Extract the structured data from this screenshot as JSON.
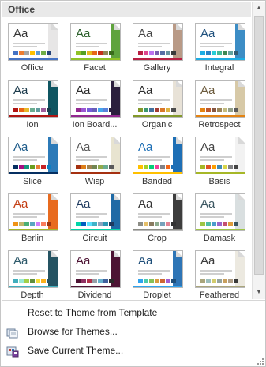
{
  "header": {
    "title": "Office"
  },
  "themes": [
    {
      "name": "Office",
      "aa": "#333333",
      "side": "#e7e6e6",
      "bar": "#4472c4",
      "sw": [
        "#4472c4",
        "#ed7d31",
        "#a5a5a5",
        "#ffc000",
        "#5b9bd5",
        "#70ad47",
        "#264478"
      ]
    },
    {
      "name": "Facet",
      "aa": "#2a5f2a",
      "side": "#5fa33d",
      "bar": "#90c226",
      "sw": [
        "#90c226",
        "#54a021",
        "#e6b91e",
        "#e76618",
        "#c42f1a",
        "#918655",
        "#3a6b1b"
      ]
    },
    {
      "name": "Gallery",
      "aa": "#444444",
      "side": "#b99a86",
      "bar": "#b71e42",
      "sw": [
        "#b71e42",
        "#de478e",
        "#bc72f0",
        "#795faf",
        "#586ea6",
        "#6892a0",
        "#3a3a3a"
      ]
    },
    {
      "name": "Integral",
      "aa": "#1d4f7c",
      "side": "#3c8dc5",
      "bar": "#1cade4",
      "sw": [
        "#1cade4",
        "#2683c6",
        "#27ced7",
        "#42ba97",
        "#3e8853",
        "#62a39f",
        "#335b74"
      ]
    },
    {
      "name": "Ion",
      "aa": "#1b3a4b",
      "side": "#0f5561",
      "bar": "#b01513",
      "sw": [
        "#b01513",
        "#ea6312",
        "#e6b729",
        "#6aac90",
        "#5f9c9d",
        "#9e5e9b",
        "#1b3a4b"
      ]
    },
    {
      "name": "Ion Board...",
      "aa": "#2a2a2a",
      "side": "#2b1f3d",
      "bar": "#92278f",
      "sw": [
        "#92278f",
        "#9b57d3",
        "#755dd9",
        "#665eb8",
        "#45a5ed",
        "#5982db",
        "#2b1f3d"
      ]
    },
    {
      "name": "Organic",
      "aa": "#2a2a2a",
      "side": "#e8e2d7",
      "bar": "#83992a",
      "sw": [
        "#83992a",
        "#3c9770",
        "#44709d",
        "#a23c33",
        "#d97828",
        "#deb340",
        "#4d4d4d"
      ]
    },
    {
      "name": "Retrospect",
      "aa": "#6b5a3c",
      "side": "#d7c9a7",
      "bar": "#e48312",
      "sw": [
        "#e48312",
        "#bd582c",
        "#865640",
        "#9b8357",
        "#c2bc80",
        "#94a088",
        "#5a5a5a"
      ]
    },
    {
      "name": "Slice",
      "aa": "#1e5c8a",
      "side": "#2c7ab8",
      "bar": "#052f61",
      "sw": [
        "#052f61",
        "#a50e82",
        "#14967c",
        "#6a9e1f",
        "#e87d37",
        "#c62324",
        "#0b7fc3"
      ]
    },
    {
      "name": "Wisp",
      "aa": "#555555",
      "side": "#e8e4d0",
      "bar": "#a53010",
      "sw": [
        "#a53010",
        "#de7e18",
        "#9f8351",
        "#728653",
        "#92aa4c",
        "#6aac91",
        "#5a5a5a"
      ]
    },
    {
      "name": "Banded",
      "aa": "#1e6fb5",
      "side": "#1e6fb5",
      "bar": "#ffc000",
      "sw": [
        "#ffc000",
        "#a5d028",
        "#08cc78",
        "#f24099",
        "#828288",
        "#f56617",
        "#1e6fb5"
      ]
    },
    {
      "name": "Basis",
      "aa": "#444444",
      "side": "#f2f2f2",
      "bar": "#a6b727",
      "sw": [
        "#a6b727",
        "#df5327",
        "#fe9e00",
        "#418ab3",
        "#d7d447",
        "#818183",
        "#444444"
      ]
    },
    {
      "name": "Berlin",
      "aa": "#c33e14",
      "side": "#e86b1f",
      "bar": "#a6b727",
      "sw": [
        "#f09415",
        "#c1b56b",
        "#4baf73",
        "#5aa6c0",
        "#d17df9",
        "#fa7e5c",
        "#9e3611"
      ]
    },
    {
      "name": "Circuit",
      "aa": "#1e3a5f",
      "side": "#1f6aa5",
      "bar": "#03d4a8",
      "sw": [
        "#03d4a8",
        "#005cbf",
        "#5ae0ff",
        "#3fb2c7",
        "#8ca3be",
        "#2d98b4",
        "#1e3a5f"
      ]
    },
    {
      "name": "Crop",
      "aa": "#333333",
      "side": "#3d3d3d",
      "bar": "#8c8d86",
      "sw": [
        "#8c8d86",
        "#e6c069",
        "#897b61",
        "#8dab8e",
        "#77a2bb",
        "#e28394",
        "#333333"
      ]
    },
    {
      "name": "Damask",
      "aa": "#3a5560",
      "side": "#d9dfe0",
      "bar": "#9ec544",
      "sw": [
        "#9ec544",
        "#50bea3",
        "#4a9ccc",
        "#9a66ca",
        "#c54f71",
        "#de9c3c",
        "#3a5560"
      ]
    },
    {
      "name": "Depth",
      "aa": "#2e5a6b",
      "side": "#255362",
      "bar": "#41aebd",
      "sw": [
        "#41aebd",
        "#97e9d5",
        "#a2cf49",
        "#608f3d",
        "#f4de3a",
        "#fcb11c",
        "#255362"
      ]
    },
    {
      "name": "Dividend",
      "aa": "#4d1434",
      "side": "#4d1434",
      "bar": "#4d1434",
      "sw": [
        "#4d1434",
        "#903163",
        "#b2324b",
        "#969fa7",
        "#66b1ce",
        "#40619d",
        "#2a2a2a"
      ]
    },
    {
      "name": "Droplet",
      "aa": "#1e4e79",
      "side": "#2e75b6",
      "bar": "#2fa3ee",
      "sw": [
        "#2fa3ee",
        "#4bcaad",
        "#86c157",
        "#d99c3f",
        "#ce6633",
        "#a35dd1",
        "#1e4e79"
      ]
    },
    {
      "name": "Feathered",
      "aa": "#3a3a3a",
      "side": "#ece9e0",
      "bar": "#a9a57c",
      "sw": [
        "#a9a57c",
        "#9cbebd",
        "#d2cb6c",
        "#95a39d",
        "#c89f5d",
        "#b1a089",
        "#3a3a3a"
      ]
    }
  ],
  "menu": {
    "reset_label": "Reset to Theme from Template",
    "browse_label": "Browse for Themes...",
    "save_label": "Save Current Theme..."
  }
}
